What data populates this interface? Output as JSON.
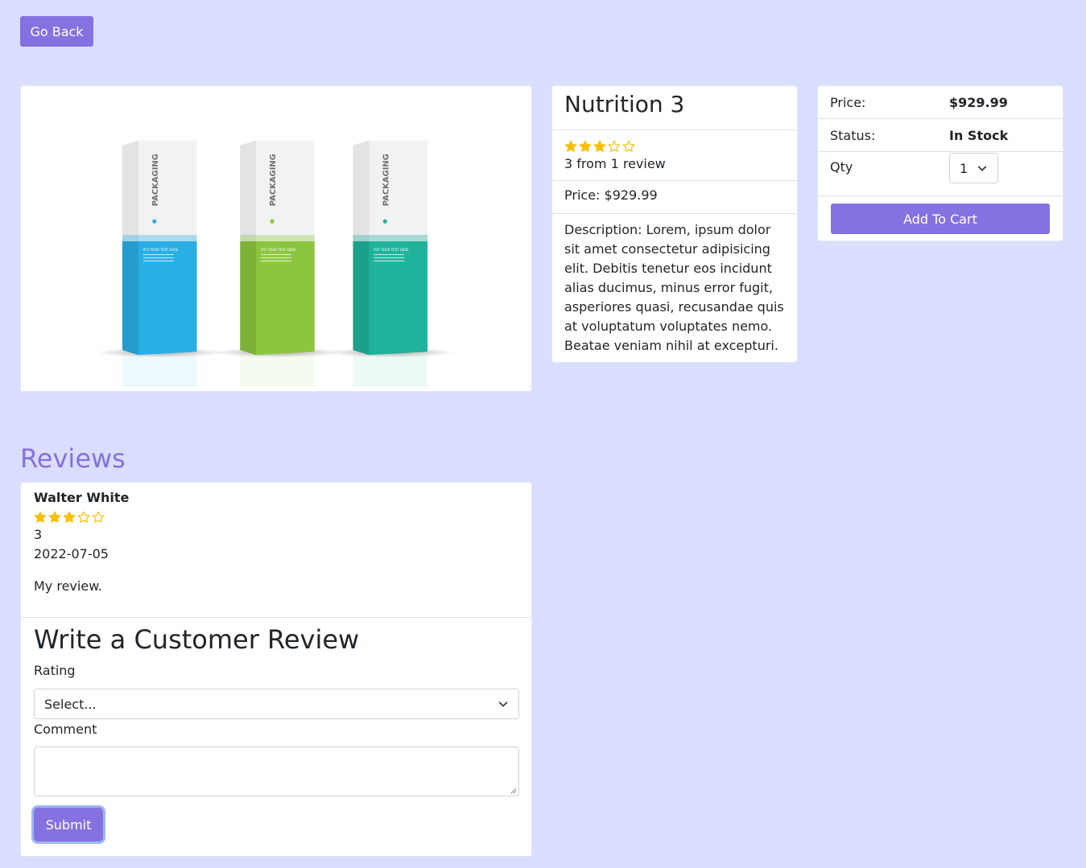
{
  "nav": {
    "go_back_label": "Go Back"
  },
  "product": {
    "name": "Nutrition 3",
    "rating": 3,
    "max_rating": 5,
    "rating_text": "3 from 1 review",
    "price_text": "Price: $929.99",
    "description": "Description: Lorem, ipsum dolor sit amet consectetur adipisicing elit. Debitis tenetur eos incidunt alias ducimus, minus error fugit, asperiores quasi, recusandae quis at voluptatum voluptates nemo. Beatae veniam nihil at excepturi.",
    "image_text": {
      "box_label": "PACKAGING",
      "box_caption": "PUT YOUR TEXT HERE"
    },
    "box_colors": [
      "#29aee6",
      "#8cc63f",
      "#1fb39b"
    ]
  },
  "cart": {
    "price_label": "Price:",
    "price_value": "$929.99",
    "status_label": "Status:",
    "status_value": "In Stock",
    "qty_label": "Qty",
    "qty_value": "1",
    "add_to_cart_label": "Add To Cart"
  },
  "reviews": {
    "title": "Reviews",
    "items": [
      {
        "author": "Walter White",
        "rating": 3,
        "rating_text": "3",
        "date": "2022-07-05",
        "comment": "My review."
      }
    ]
  },
  "review_form": {
    "title": "Write a Customer Review",
    "rating_label": "Rating",
    "rating_value": "Select...",
    "comment_label": "Comment",
    "comment_value": "",
    "submit_label": "Submit"
  },
  "colors": {
    "accent": "#8571df",
    "background": "#dadefe",
    "star": "#f8c00a"
  },
  "icons": {
    "star_full": "star-icon",
    "star_empty": "star-outline-icon",
    "dropdown": "chevron-down-icon"
  }
}
